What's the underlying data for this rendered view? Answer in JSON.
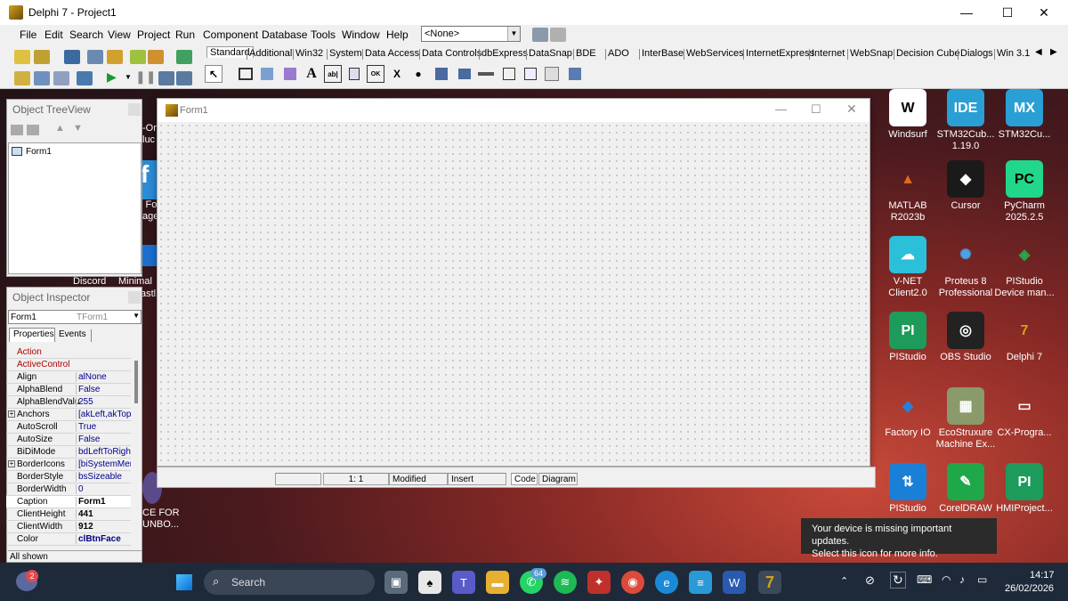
{
  "ide": {
    "title": "Delphi 7 - Project1",
    "menu": [
      "File",
      "Edit",
      "Search",
      "View",
      "Project",
      "Run",
      "Component",
      "Database",
      "Tools",
      "Window",
      "Help"
    ],
    "combo_value": "<None>",
    "palette_tabs": [
      "Standard",
      "Additional",
      "Win32",
      "System",
      "Data Access",
      "Data Controls",
      "dbExpress",
      "DataSnap",
      "BDE",
      "ADO",
      "InterBase",
      "WebServices",
      "InternetExpress",
      "Internet",
      "WebSnap",
      "Decision Cube",
      "Dialogs",
      "Win 3.1"
    ],
    "palette_glyphs": [
      "A",
      "ab|",
      "OK",
      "X",
      "●"
    ]
  },
  "treeview": {
    "title": "Object TreeView",
    "root": "Form1"
  },
  "inspector": {
    "title": "Object Inspector",
    "object": "Form1",
    "object_type": "TForm1",
    "tabs": [
      "Properties",
      "Events"
    ],
    "rows": [
      {
        "k": "Action",
        "v": ""
      },
      {
        "k": "ActiveControl",
        "v": ""
      },
      {
        "k": "Align",
        "v": "alNone"
      },
      {
        "k": "AlphaBlend",
        "v": "False"
      },
      {
        "k": "AlphaBlendValu",
        "v": "255"
      },
      {
        "k": "Anchors",
        "v": "[akLeft,akTop"
      },
      {
        "k": "AutoScroll",
        "v": "True"
      },
      {
        "k": "AutoSize",
        "v": "False"
      },
      {
        "k": "BiDiMode",
        "v": "bdLeftToRight"
      },
      {
        "k": "BorderIcons",
        "v": "[biSystemMen"
      },
      {
        "k": "BorderStyle",
        "v": "bsSizeable"
      },
      {
        "k": "BorderWidth",
        "v": "0"
      },
      {
        "k": "Caption",
        "v": "Form1"
      },
      {
        "k": "ClientHeight",
        "v": "441"
      },
      {
        "k": "ClientWidth",
        "v": "912"
      },
      {
        "k": "Color",
        "v": "clBtnFace"
      }
    ],
    "status": "All shown"
  },
  "form": {
    "title": "Form1"
  },
  "editor": {
    "position": "1:   1",
    "modified": "Modified",
    "insert": "Insert",
    "tab_code": "Code",
    "tab_diagram": "Diagram"
  },
  "desktop_partial": {
    "discord": "Discord",
    "minimal": "Minimal",
    "fragment1": "-Or",
    "fragment2": "luc",
    "fragment3": "l Fo",
    "fragment4": "age",
    "fragment5": "astl",
    "fragment6": "CE FOR",
    "fragment7": "UNBO..."
  },
  "desktop_icons": [
    {
      "label": "Windsurf",
      "color": "#ffffff",
      "glyph": "W",
      "fg": "#000000"
    },
    {
      "label": "STM32Cub... 1.19.0",
      "color": "#2a9fd6",
      "glyph": "IDE",
      "fg": "#ffffff"
    },
    {
      "label": "STM32Cu...",
      "color": "#2a9fd6",
      "glyph": "MX",
      "fg": "#ffffff"
    },
    {
      "label": "MATLAB R2023b",
      "color": "transparent",
      "glyph": "▲",
      "fg": "#e26a1b"
    },
    {
      "label": "Cursor",
      "color": "#1a1a1a",
      "glyph": "◆",
      "fg": "#ffffff"
    },
    {
      "label": "PyCharm 2025.2.5",
      "color": "#21d789",
      "glyph": "PC",
      "fg": "#000000"
    },
    {
      "label": "V-NET Client2.0",
      "color": "#2bbfd9",
      "glyph": "☁",
      "fg": "#ffffff"
    },
    {
      "label": "Proteus 8 Professional",
      "color": "transparent",
      "glyph": "✺",
      "fg": "#4aa3e8"
    },
    {
      "label": "PIStudio Device man...",
      "color": "transparent",
      "glyph": "◈",
      "fg": "#2aa84a"
    },
    {
      "label": "PIStudio",
      "color": "#1d9b5a",
      "glyph": "PI",
      "fg": "#ffffff"
    },
    {
      "label": "OBS Studio",
      "color": "#222222",
      "glyph": "◎",
      "fg": "#ffffff"
    },
    {
      "label": "Delphi 7",
      "color": "transparent",
      "glyph": "7",
      "fg": "#d4a017"
    },
    {
      "label": "Factory IO",
      "color": "transparent",
      "glyph": "◆",
      "fg": "#2a7fd6"
    },
    {
      "label": "EcoStruxure Machine Ex...",
      "color": "#8a9a6a",
      "glyph": "▦",
      "fg": "#ffffff"
    },
    {
      "label": "CX-Progra...",
      "color": "transparent",
      "glyph": "▭",
      "fg": "#ffffff"
    },
    {
      "label": "PIStudio",
      "color": "#1a7fd6",
      "glyph": "⇅",
      "fg": "#ffffff"
    },
    {
      "label": "CorelDRAW",
      "color": "#1fa84a",
      "glyph": "✎",
      "fg": "#ffffff"
    },
    {
      "label": "HMIProject...",
      "color": "#1d9b5a",
      "glyph": "PI",
      "fg": "#ffffff"
    }
  ],
  "tooltip": {
    "line1": "Your device is missing important updates.",
    "line2": "Select this icon for more info."
  },
  "taskbar": {
    "search": "Search",
    "notif_count": "2",
    "whatsapp_badge": "64",
    "time": "14:17",
    "date": "26/02/2026"
  }
}
